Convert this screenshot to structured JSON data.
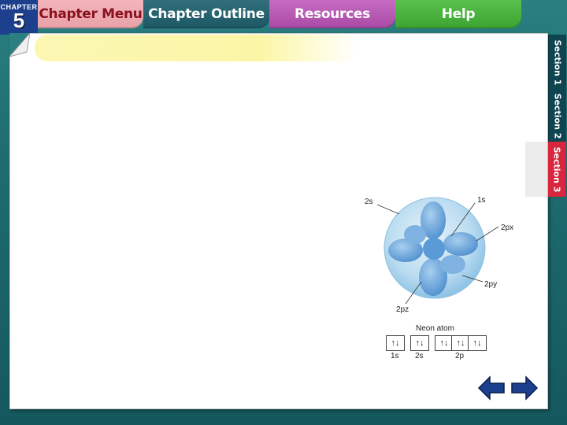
{
  "nav": {
    "chapter_label": "CHAPTER",
    "chapter_number": "5",
    "tabs": [
      "Chapter Menu",
      "Chapter Outline",
      "Resources",
      "Help"
    ]
  },
  "sections": [
    "Section 1",
    "Section 2",
    "Section 3"
  ],
  "active_section_index": 2,
  "title": "",
  "diagram": {
    "labels": {
      "s2": "2s",
      "s1": "1s",
      "px": "2px",
      "py": "2py",
      "pz": "2pz"
    },
    "atom_caption": "Neon atom",
    "orbital_boxes": [
      "↑↓",
      "↑↓",
      "↑↓",
      "↑↓",
      "↑↓"
    ],
    "orbital_labels": [
      "1s",
      "2s",
      "2p"
    ]
  },
  "colors": {
    "background": "#1f6d70",
    "chapter_menu_tab": "#e9a1a8",
    "chapter_outline_tab": "#1d5965",
    "resources_tab": "#a94aa5",
    "help_tab": "#3da433",
    "active_section": "#d7263d",
    "arrow": "#1c3f8e"
  },
  "icons": [
    "page-curl-icon",
    "previous-arrow-icon",
    "next-arrow-icon"
  ]
}
